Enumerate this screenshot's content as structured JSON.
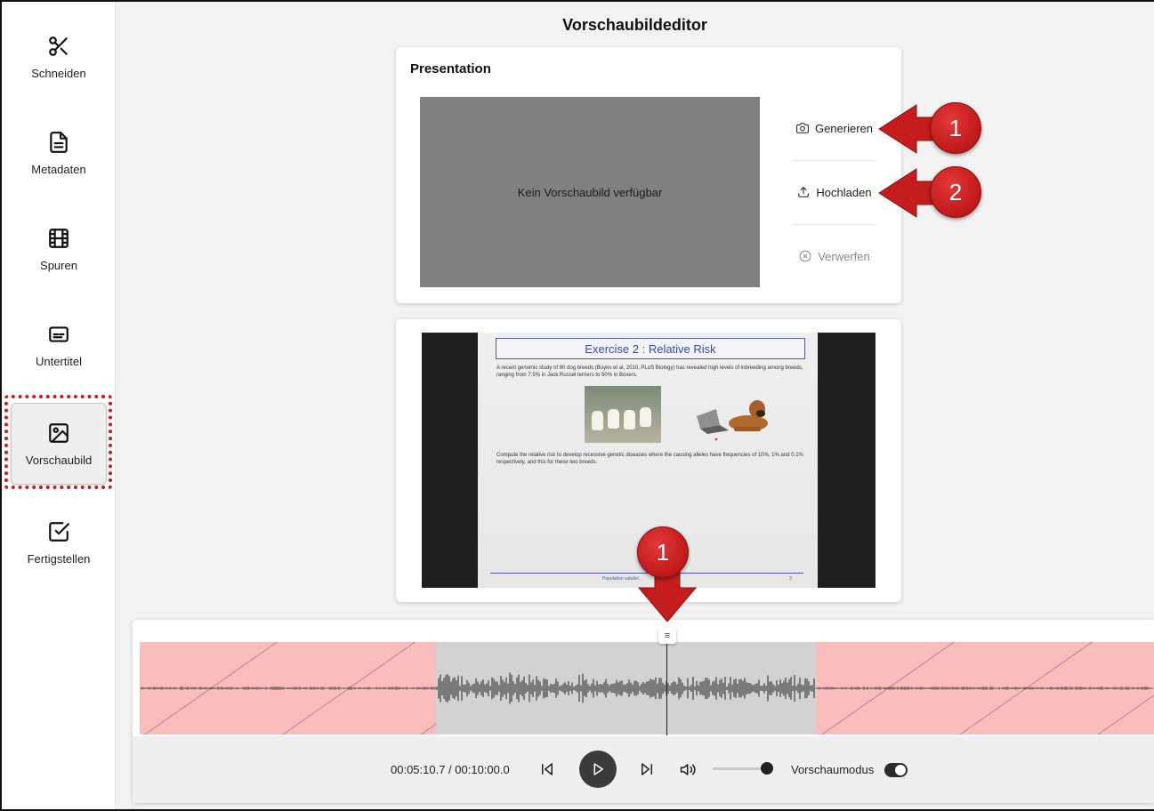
{
  "page_title": "Vorschaubildeditor",
  "sidebar": {
    "items": [
      {
        "label": "Schneiden",
        "icon": "scissors-icon"
      },
      {
        "label": "Metadaten",
        "icon": "document-icon"
      },
      {
        "label": "Spuren",
        "icon": "film-icon"
      },
      {
        "label": "Untertitel",
        "icon": "subtitles-icon"
      },
      {
        "label": "Vorschaubild",
        "icon": "image-icon",
        "active": true
      },
      {
        "label": "Fertigstellen",
        "icon": "checkbox-icon"
      }
    ]
  },
  "thumbnail_card": {
    "title": "Presentation",
    "placeholder": "Kein Vorschaubild verfügbar",
    "actions": {
      "generate": "Generieren",
      "upload": "Hochladen",
      "discard": "Verwerfen"
    }
  },
  "slide": {
    "title": "Exercise 2 : Relative Risk",
    "text1": "A recent genomic study of 80 dog breeds (Boyko et al, 2010, PLoS Biology) has revealed  high levels of inbreeding among breeds, ranging from 7.5% in Jack Russel terriers to 50% in Boxers.",
    "text2": "Compute the relative risk to develop recessive genetic diseases where the causing alleles  have frequencies of 10%, 1% and 0.1% respectively, and this for these two breeds.",
    "footer": "Population subdivi...",
    "page": "3"
  },
  "player": {
    "time": "00:05:10.7 / 00:10:00.0",
    "volume_level": 1.0,
    "preview_mode_label": "Vorschaumodus",
    "preview_mode_on": true
  },
  "callouts": {
    "generate_badge": "1",
    "upload_badge": "2",
    "playhead_badge": "1"
  },
  "colors": {
    "accent_red": "#c51d1d",
    "cut_region": "#fbbcbd",
    "kept_region": "#d2d2d2"
  }
}
